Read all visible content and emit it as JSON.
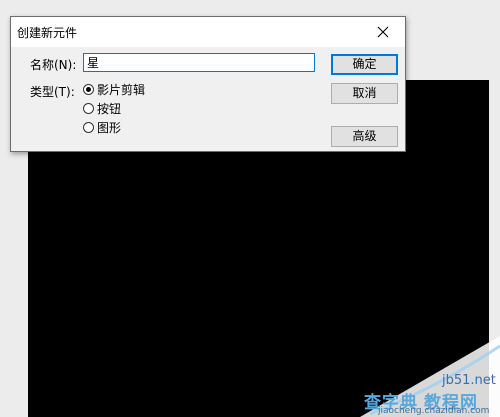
{
  "dialog": {
    "title": "创建新元件",
    "name_label": "名称(N):",
    "name_value": "星",
    "type_label": "类型(T):",
    "types": [
      {
        "label": "影片剪辑",
        "checked": true
      },
      {
        "label": "按钮",
        "checked": false
      },
      {
        "label": "图形",
        "checked": false
      }
    ],
    "buttons": {
      "ok": "确定",
      "cancel": "取消",
      "advanced": "高级"
    }
  },
  "watermark": {
    "site": "jb51.net",
    "line1": "查字典",
    "line2": "教程网",
    "url": "jiaocheng.chazidian.com"
  },
  "colors": {
    "stage": "#000000",
    "accent": "#0078d7",
    "watermark": "#4a9bd6"
  }
}
